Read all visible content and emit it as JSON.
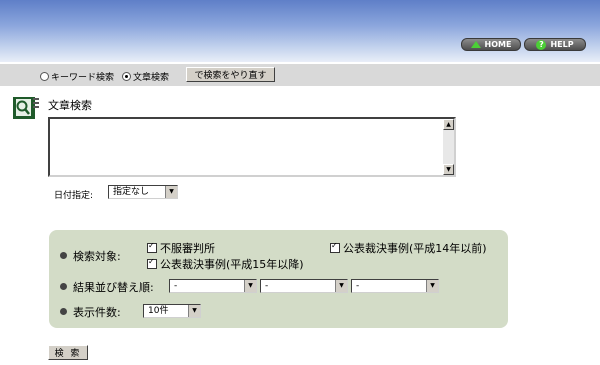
{
  "header": {
    "home_label": "HOME",
    "help_label": "HELP"
  },
  "mode": {
    "keyword_label": "キーワード検索",
    "text_label": "文章検索",
    "selected": "text",
    "reset_label": "で検索をやり直す"
  },
  "form": {
    "title": "文章検索",
    "textarea_value": "",
    "date_label": "日付指定:",
    "date_value": "指定なし"
  },
  "options": {
    "target_label": "検索対象:",
    "targets": [
      {
        "label": "不服審判所",
        "checked": true
      },
      {
        "label": "公表裁決事例(平成14年以前)",
        "checked": true
      },
      {
        "label": "公表裁決事例(平成15年以降)",
        "checked": true
      }
    ],
    "sort_label": "結果並び替え順:",
    "sort_values": [
      "-",
      "-",
      "-"
    ],
    "count_label": "表示件数:",
    "count_value": "10件"
  },
  "search_label": "検 索",
  "colors": {
    "header_top": "#5f7fc8",
    "panel": "#d3dcc7",
    "icon_green": "#4bcf36"
  }
}
